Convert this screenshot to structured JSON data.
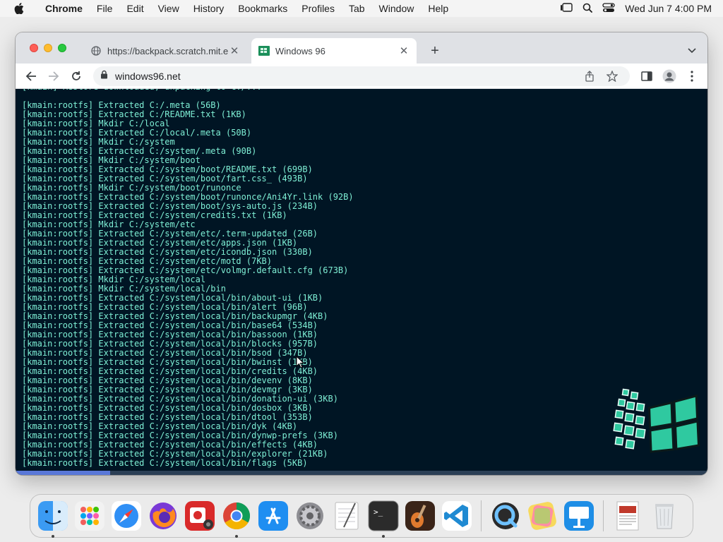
{
  "menubar": {
    "app_name": "Chrome",
    "items": [
      "File",
      "Edit",
      "View",
      "History",
      "Bookmarks",
      "Profiles",
      "Tab",
      "Window",
      "Help"
    ],
    "clock": "Wed Jun 7  4:00 PM"
  },
  "browser": {
    "tabs": [
      {
        "title": "https://backpack.scratch.mit.e",
        "active": false,
        "icon": "globe-icon"
      },
      {
        "title": "Windows 96",
        "active": true,
        "icon": "windows96-icon"
      }
    ],
    "url": "windows96.net"
  },
  "terminal": {
    "lines": [
      "[kmain] Restore downloaded, unpacking to C:/...",
      "",
      "[kmain:rootfs] Extracted C:/.meta (56B)",
      "[kmain:rootfs] Extracted C:/README.txt (1KB)",
      "[kmain:rootfs] Mkdir C:/local",
      "[kmain:rootfs] Extracted C:/local/.meta (50B)",
      "[kmain:rootfs] Mkdir C:/system",
      "[kmain:rootfs] Extracted C:/system/.meta (90B)",
      "[kmain:rootfs] Mkdir C:/system/boot",
      "[kmain:rootfs] Extracted C:/system/boot/README.txt (699B)",
      "[kmain:rootfs] Extracted C:/system/boot/fart.css_ (493B)",
      "[kmain:rootfs] Mkdir C:/system/boot/runonce",
      "[kmain:rootfs] Extracted C:/system/boot/runonce/Ani4Yr.link (92B)",
      "[kmain:rootfs] Extracted C:/system/boot/sys-auto.js (234B)",
      "[kmain:rootfs] Extracted C:/system/credits.txt (1KB)",
      "[kmain:rootfs] Mkdir C:/system/etc",
      "[kmain:rootfs] Extracted C:/system/etc/.term-updated (26B)",
      "[kmain:rootfs] Extracted C:/system/etc/apps.json (1KB)",
      "[kmain:rootfs] Extracted C:/system/etc/icondb.json (330B)",
      "[kmain:rootfs] Extracted C:/system/etc/motd (7KB)",
      "[kmain:rootfs] Extracted C:/system/etc/volmgr.default.cfg (673B)",
      "[kmain:rootfs] Mkdir C:/system/local",
      "[kmain:rootfs] Mkdir C:/system/local/bin",
      "[kmain:rootfs] Extracted C:/system/local/bin/about-ui (1KB)",
      "[kmain:rootfs] Extracted C:/system/local/bin/alert (96B)",
      "[kmain:rootfs] Extracted C:/system/local/bin/backupmgr (4KB)",
      "[kmain:rootfs] Extracted C:/system/local/bin/base64 (534B)",
      "[kmain:rootfs] Extracted C:/system/local/bin/bassoon (1KB)",
      "[kmain:rootfs] Extracted C:/system/local/bin/blocks (957B)",
      "[kmain:rootfs] Extracted C:/system/local/bin/bsod (347B)",
      "[kmain:rootfs] Extracted C:/system/local/bin/bwinst (1KB)",
      "[kmain:rootfs] Extracted C:/system/local/bin/credits (4KB)",
      "[kmain:rootfs] Extracted C:/system/local/bin/devenv (8KB)",
      "[kmain:rootfs] Extracted C:/system/local/bin/devmgr (3KB)",
      "[kmain:rootfs] Extracted C:/system/local/bin/donation-ui (3KB)",
      "[kmain:rootfs] Extracted C:/system/local/bin/dosbox (3KB)",
      "[kmain:rootfs] Extracted C:/system/local/bin/dtool (353B)",
      "[kmain:rootfs] Extracted C:/system/local/bin/dyk (4KB)",
      "[kmain:rootfs] Extracted C:/system/local/bin/dynwp-prefs (3KB)",
      "[kmain:rootfs] Extracted C:/system/local/bin/effects (4KB)",
      "[kmain:rootfs] Extracted C:/system/local/bin/explorer (21KB)",
      "[kmain:rootfs] Extracted C:/system/local/bin/flags (5KB)"
    ],
    "progress": 0.137
  },
  "dock": {
    "items": [
      {
        "name": "finder",
        "running": true
      },
      {
        "name": "launchpad",
        "running": false
      },
      {
        "name": "safari",
        "running": false
      },
      {
        "name": "firefox",
        "running": false
      },
      {
        "name": "photo-booth",
        "running": false
      },
      {
        "name": "chrome",
        "running": true
      },
      {
        "name": "app-store",
        "running": false
      },
      {
        "name": "system-preferences",
        "running": false
      },
      {
        "name": "textedit",
        "running": false
      },
      {
        "name": "terminal",
        "running": true
      },
      {
        "name": "garageband",
        "running": false
      },
      {
        "name": "vscode",
        "running": false
      },
      {
        "name": "quicktime",
        "running": false
      },
      {
        "name": "pixelmator",
        "running": false
      },
      {
        "name": "keynote",
        "running": false
      },
      {
        "name": "document",
        "running": false
      },
      {
        "name": "trash",
        "running": false
      }
    ]
  }
}
